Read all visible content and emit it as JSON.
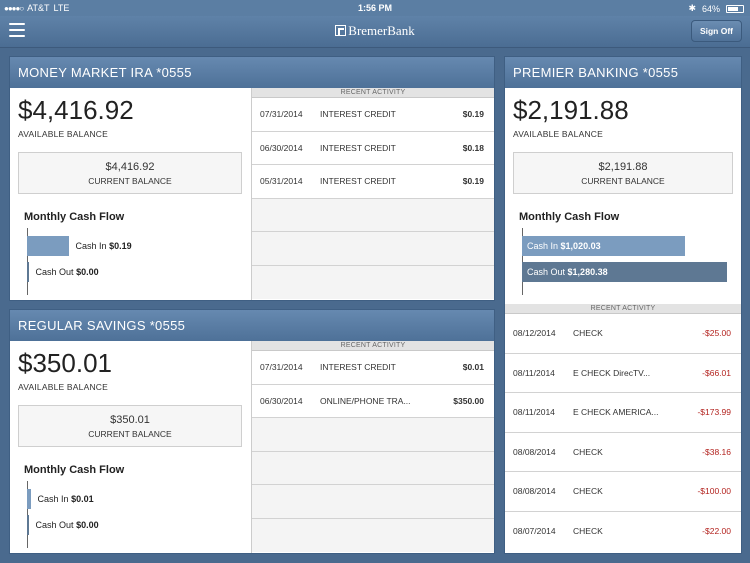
{
  "status": {
    "signal_dots": "●●●●○",
    "carrier": "AT&T",
    "network": "LTE",
    "time": "1:56 PM",
    "bluetooth": "✱",
    "battery_pct": "64%",
    "battery_level": 0.64
  },
  "nav": {
    "brand": "BremerBank",
    "sign_off": "Sign Off"
  },
  "colors": {
    "cash_in_bar": "#7b9cbf",
    "cash_out_bar": "#5e7893",
    "negative_amount": "#b3231f"
  },
  "accounts": {
    "money_market": {
      "title": "MONEY MARKET IRA *0555",
      "balance": "$4,416.92",
      "balance_label": "AVAILABLE BALANCE",
      "current_value": "$4,416.92",
      "current_label": "CURRENT BALANCE",
      "cash_flow_title": "Monthly Cash Flow",
      "cash_in_label": "Cash In",
      "cash_in": "$0.19",
      "cash_out_label": "Cash Out",
      "cash_out": "$0.00",
      "activity_title": "RECENT ACTIVITY",
      "activity": [
        {
          "date": "07/31/2014",
          "desc": "INTEREST CREDIT",
          "amount": "$0.19"
        },
        {
          "date": "06/30/2014",
          "desc": "INTEREST CREDIT",
          "amount": "$0.18"
        },
        {
          "date": "05/31/2014",
          "desc": "INTEREST CREDIT",
          "amount": "$0.19"
        }
      ]
    },
    "regular_savings": {
      "title": "REGULAR SAVINGS *0555",
      "balance": "$350.01",
      "balance_label": "AVAILABLE BALANCE",
      "current_value": "$350.01",
      "current_label": "CURRENT BALANCE",
      "cash_flow_title": "Monthly Cash Flow",
      "cash_in_label": "Cash In",
      "cash_in": "$0.01",
      "cash_out_label": "Cash Out",
      "cash_out": "$0.00",
      "activity_title": "RECENT ACTIVITY",
      "activity": [
        {
          "date": "07/31/2014",
          "desc": "INTEREST CREDIT",
          "amount": "$0.01"
        },
        {
          "date": "06/30/2014",
          "desc": "ONLINE/PHONE TRA...",
          "amount": "$350.00"
        }
      ]
    },
    "premier": {
      "title": "PREMIER BANKING *0555",
      "balance": "$2,191.88",
      "balance_label": "AVAILABLE BALANCE",
      "current_value": "$2,191.88",
      "current_label": "CURRENT BALANCE",
      "cash_flow_title": "Monthly Cash Flow",
      "cash_in_label": "Cash In",
      "cash_in": "$1,020.03",
      "cash_out_label": "Cash Out",
      "cash_out": "$1,280.38",
      "activity_title": "RECENT ACTIVITY",
      "activity": [
        {
          "date": "08/12/2014",
          "desc": "CHECK",
          "amount": "-$25.00"
        },
        {
          "date": "08/11/2014",
          "desc": "E CHECK DirecTV...",
          "amount": "-$66.01"
        },
        {
          "date": "08/11/2014",
          "desc": "E CHECK AMERICA...",
          "amount": "-$173.99"
        },
        {
          "date": "08/08/2014",
          "desc": "CHECK",
          "amount": "-$38.16"
        },
        {
          "date": "08/08/2014",
          "desc": "CHECK",
          "amount": "-$100.00"
        },
        {
          "date": "08/07/2014",
          "desc": "CHECK",
          "amount": "-$22.00"
        }
      ]
    }
  }
}
